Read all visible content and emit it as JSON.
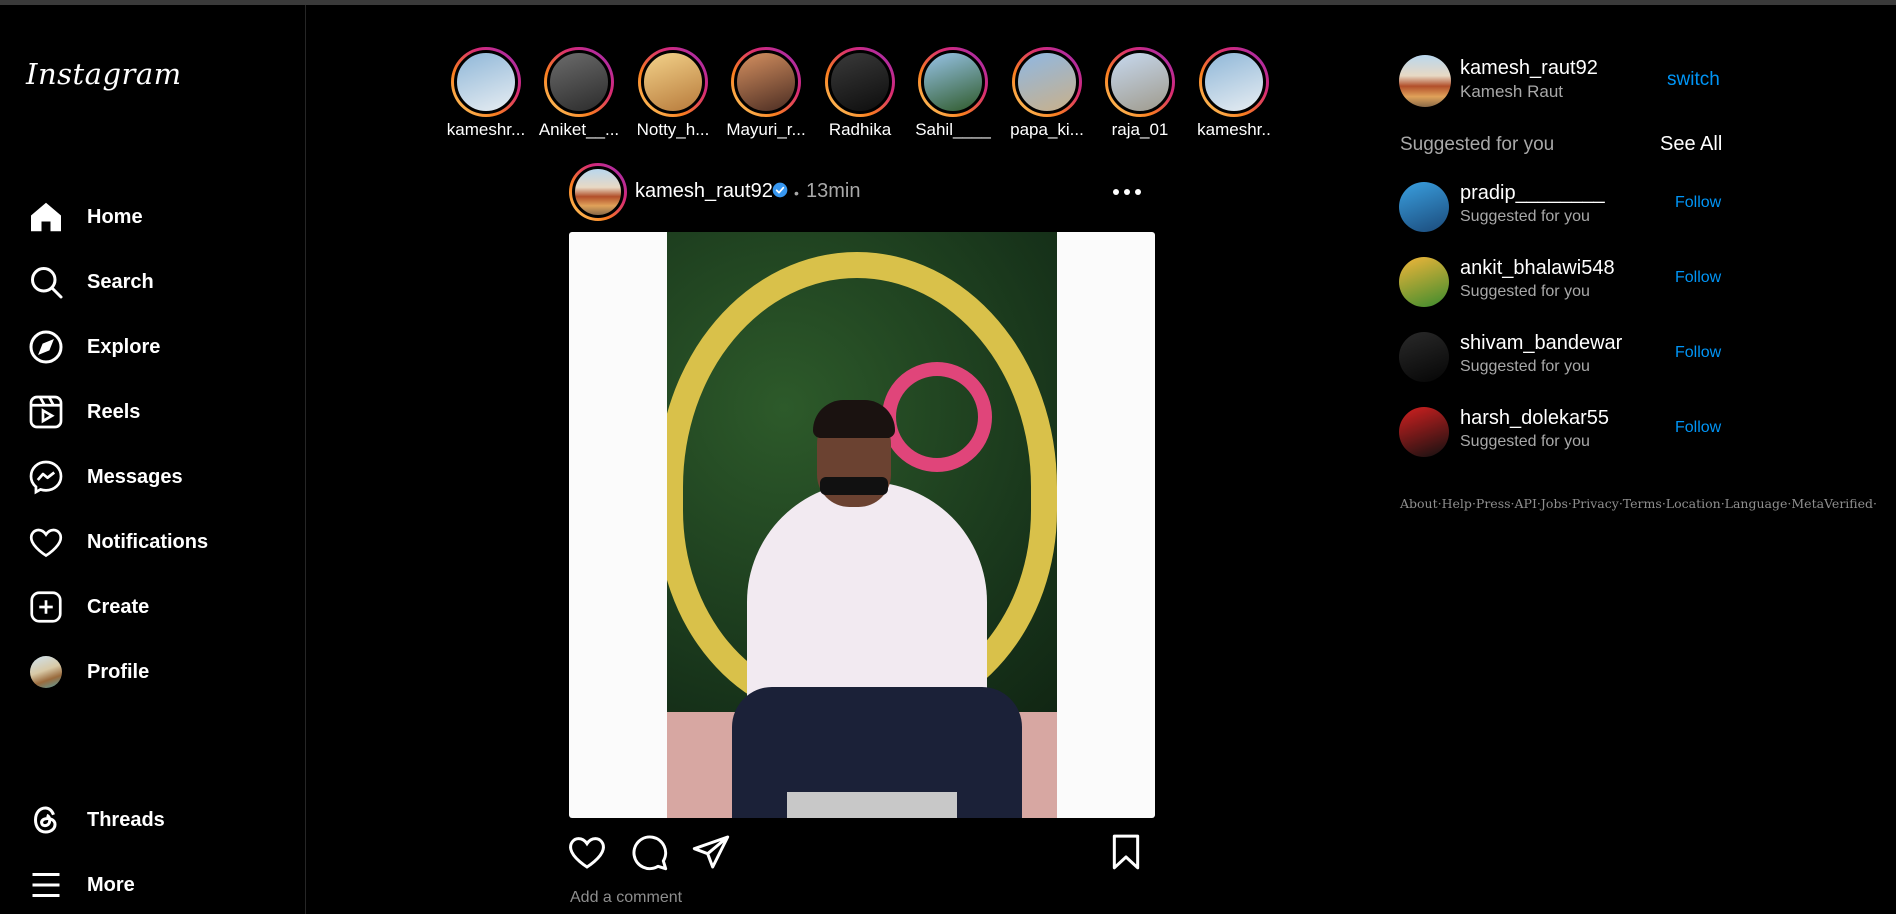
{
  "sidebar": {
    "logo": "Instagram",
    "items": [
      {
        "label": "Home",
        "icon": "home-icon"
      },
      {
        "label": "Search",
        "icon": "search-icon"
      },
      {
        "label": "Explore",
        "icon": "compass-icon"
      },
      {
        "label": "Reels",
        "icon": "reels-icon"
      },
      {
        "label": "Messages",
        "icon": "messenger-icon"
      },
      {
        "label": "Notifications",
        "icon": "heart-icon"
      },
      {
        "label": "Create",
        "icon": "plus-square-icon"
      },
      {
        "label": "Profile",
        "icon": "profile-avatar"
      },
      {
        "label": "Threads",
        "icon": "threads-icon"
      },
      {
        "label": "More",
        "icon": "hamburger-icon"
      }
    ]
  },
  "stories": [
    {
      "name": "kameshr...",
      "colors": [
        "#8fb7d8",
        "#e7edf2"
      ]
    },
    {
      "name": "Aniket__...",
      "colors": [
        "#6c6c6c",
        "#2b2b2b"
      ]
    },
    {
      "name": "Notty_h...",
      "colors": [
        "#f3d28a",
        "#b77a3b"
      ]
    },
    {
      "name": "Mayuri_r...",
      "colors": [
        "#d59060",
        "#4a2c22"
      ]
    },
    {
      "name": "Radhika",
      "colors": [
        "#3a3a3a",
        "#0d0d0d"
      ]
    },
    {
      "name": "Sahil____",
      "colors": [
        "#98c4e8",
        "#2f5a2a"
      ]
    },
    {
      "name": "papa_ki...",
      "colors": [
        "#8fb8e3",
        "#c9b08a"
      ]
    },
    {
      "name": "raja_01",
      "colors": [
        "#c7d9ef",
        "#9f9a8c"
      ]
    },
    {
      "name": "kameshr..",
      "colors": [
        "#8fb7d8",
        "#e7edf2"
      ]
    }
  ],
  "post": {
    "username": "kamesh_raut92",
    "time_sep": "•",
    "time": "13min",
    "comment_placeholder": "Add a comment"
  },
  "account": {
    "username": "kamesh_raut92",
    "name": "Kamesh Raut",
    "switch_label": "switch"
  },
  "suggestions": {
    "title": "Suggested for you",
    "see_all": "See All",
    "follow_label": "Follow",
    "items": [
      {
        "username": "pradip________",
        "subtitle": "Suggested for you",
        "colors": [
          "#3aa0e0",
          "#1b4a7a"
        ]
      },
      {
        "username": "ankit_bhalawi548",
        "subtitle": "Suggested for you",
        "colors": [
          "#f2b63a",
          "#3b8b2e"
        ]
      },
      {
        "username": "shivam_bandewar",
        "subtitle": "Suggested for you",
        "colors": [
          "#2a2a2a",
          "#050505"
        ]
      },
      {
        "username": "harsh_dolekar55",
        "subtitle": "Suggested for you",
        "colors": [
          "#d32020",
          "#111111"
        ]
      }
    ]
  },
  "footer": [
    "About",
    "Help",
    "Press",
    "API",
    "Jobs",
    "Privacy",
    "Terms",
    "Location",
    "Language",
    "MetaVerified"
  ],
  "colors": {
    "accent": "#0095f6",
    "muted": "#a8a8a8",
    "background": "#000000"
  }
}
